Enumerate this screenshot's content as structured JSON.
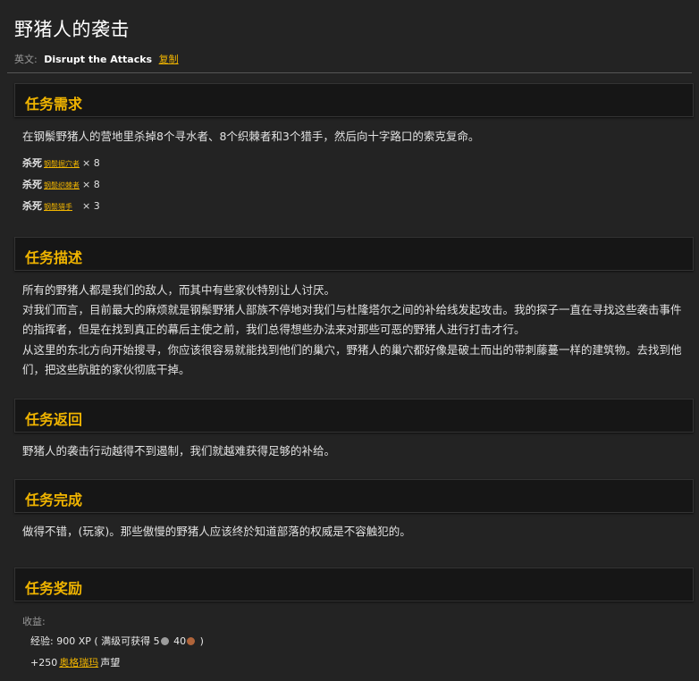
{
  "page": {
    "title": "野猪人的袭击",
    "en_label": "英文:",
    "en_name": "Disrupt the Attacks",
    "copy_label": "复制"
  },
  "sections": {
    "requirements": {
      "heading": "任务需求",
      "text": "在钢鬃野猪人的营地里杀掉8个寻水者、8个织棘者和3个猎手，然后向十字路口的索克复命。",
      "kills": [
        {
          "kill": "杀死",
          "npc": "钢鬃掘穴者",
          "count": "× 8"
        },
        {
          "kill": "杀死",
          "npc": "钢鬃织棘者",
          "count": "× 8"
        },
        {
          "kill": "杀死",
          "npc": "钢鬃猎手",
          "count": "× 3"
        }
      ]
    },
    "description": {
      "heading": "任务描述",
      "p1": "所有的野猪人都是我们的敌人，而其中有些家伙特别让人讨厌。",
      "p2a": "对我们而言，目前最大的麻烦就是钢鬃野猪人部族不停地对我们与杜隆塔尔之间的补给线发起攻击。我的探子一直在寻找这些袭击事件",
      "p2b": "的指挥者，但是在找到真正的幕后主使之前，我们总得想些办法来对那些可恶的野猪人进行打击才行。",
      "p3a": "从这里的东北方向开始搜寻，你应该很容易就能找到他们的巢穴，野猪人的巢穴都好像是破土而出的带刺藤蔓一样的建筑物。去找到他",
      "p3b": "们，把这些肮脏的家伙彻底干掉。"
    },
    "progress": {
      "heading": "任务返回",
      "text": "野猪人的袭击行动越得不到遏制，我们就越难获得足够的补给。"
    },
    "completion": {
      "heading": "任务完成",
      "text": "做得不错，(玩家)。那些傲慢的野猪人应该终於知道部落的权威是不容触犯的。"
    },
    "rewards": {
      "heading": "任务奖励",
      "gain_label": "收益:",
      "xp_prefix": "经验: 900 XP ( 满级可获得 5",
      "xp_mid": "40",
      "xp_suffix": ")",
      "rep_prefix": "+250",
      "rep_faction": "奥格瑞玛",
      "rep_suffix": "声望"
    }
  },
  "colors": {
    "accent": "#f0b400",
    "background": "#232323",
    "header_bg": "#161616",
    "silver": "#9c9c9c",
    "copper": "#b0643a"
  }
}
